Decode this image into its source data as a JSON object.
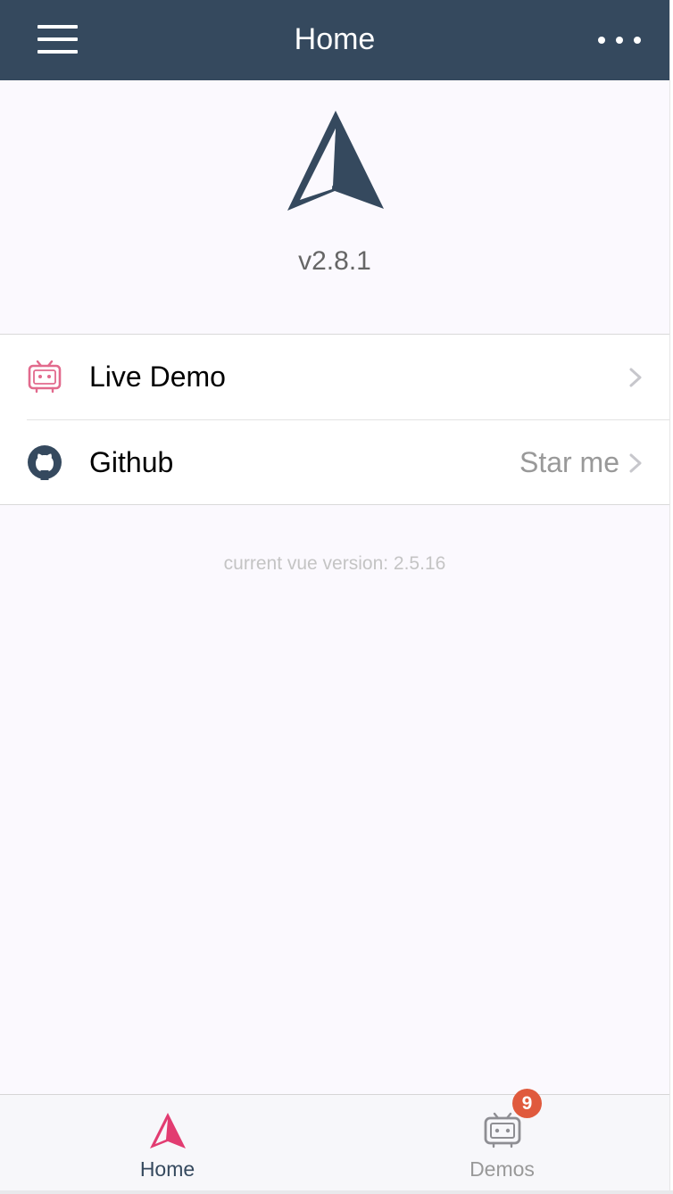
{
  "header": {
    "title": "Home",
    "menu_icon": "hamburger-menu-icon",
    "more_icon": "ellipsis-icon"
  },
  "logo": {
    "icon": "vux-logo-icon",
    "version": "v2.8.1"
  },
  "cells": [
    {
      "label": "Live Demo",
      "value": "",
      "icon": "tv-icon",
      "icon_color": "#e26a8d"
    },
    {
      "label": "Github",
      "value": "Star me",
      "icon": "github-icon",
      "icon_color": "#35495e"
    }
  ],
  "footer_note": "current vue version: 2.5.16",
  "tabbar": {
    "tabs": [
      {
        "label": "Home",
        "icon": "vux-logo-icon",
        "active": true
      },
      {
        "label": "Demos",
        "icon": "tv-icon",
        "badge": "9",
        "active": false
      }
    ]
  },
  "colors": {
    "header_bg": "#35495e",
    "page_bg": "#fbf9fe",
    "accent_pink": "#e23c71",
    "badge": "#e05a3d",
    "muted_text": "#999999"
  }
}
